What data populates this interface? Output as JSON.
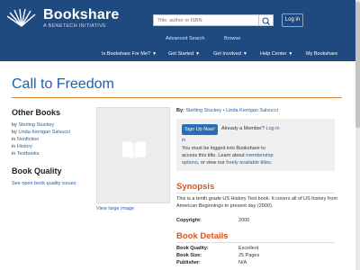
{
  "header": {
    "logo_name": "Bookshare",
    "logo_sub": "A BENETECH INITIATIVE",
    "search_placeholder": "Title, author or ISBN",
    "login_label": "Log in",
    "subnav": [
      "Advanced Search",
      "Browse"
    ],
    "mainnav": [
      "Is Bookshare For Me?",
      "Get Started",
      "Get Involved",
      "Help Center",
      "My Bookshare"
    ]
  },
  "page": {
    "title": "Call to Freedom"
  },
  "sidebar": {
    "other_books_heading": "Other Books",
    "by_prefix": "by",
    "in_prefix": "in",
    "authors": [
      "Sterling Stuckey",
      "Linda Kerrigan Salvucci"
    ],
    "categories": [
      "Nonfiction",
      "History",
      "Textbooks"
    ],
    "quality_heading": "Book Quality",
    "quality_link": "See open book quality issues"
  },
  "cover": {
    "view_large": "View large image"
  },
  "book": {
    "by_label": "By:",
    "authors_text": "Sterling Stuckey • Linda Kerrigan Salvucci",
    "signup_label": "Sign Up Now!",
    "already_text": "Already a Member?",
    "log_in_link": "Log in",
    "log_in_link_cont": "in",
    "must_login": "You must be logged into Bookshare to",
    "access_text": "access this title. Learn about",
    "membership_link": "membership",
    "options_link": "options",
    "or_view_text": ", or view our",
    "freely_link": "freely available titles",
    "freely_suffix": "."
  },
  "synopsis": {
    "heading": "Synopsis",
    "line1": "This is a tenth grade US History Text book. It covers all of US history from",
    "line2": "American Beginnings to present day (2000).",
    "copyright_label": "Copyright:",
    "copyright_value": "2000"
  },
  "details": {
    "heading": "Book Details",
    "quality_label": "Book Quality:",
    "quality_value": "Excellent",
    "size_label": "Book Size:",
    "size_value": "25 Pages",
    "publisher_label": "Publisher:",
    "publisher_value": "N/A"
  },
  "colors": {
    "header_bg": "#1f4a80",
    "link": "#1f5fa6",
    "accent_orange": "#d9541e",
    "signup_blue": "#2d6cb3"
  }
}
